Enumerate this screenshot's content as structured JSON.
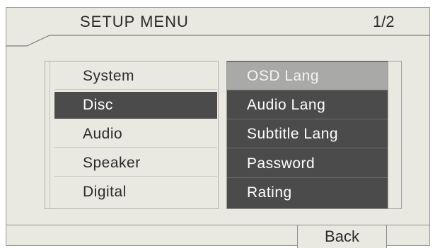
{
  "header": {
    "title": "SETUP MENU",
    "page_indicator": "1/2"
  },
  "left_menu": {
    "items": [
      {
        "label": "System",
        "selected": false
      },
      {
        "label": "Disc",
        "selected": true
      },
      {
        "label": "Audio",
        "selected": false
      },
      {
        "label": "Speaker",
        "selected": false
      },
      {
        "label": "Digital",
        "selected": false
      }
    ]
  },
  "right_menu": {
    "items": [
      {
        "label": "OSD Lang",
        "selected": true
      },
      {
        "label": "Audio Lang",
        "selected": false
      },
      {
        "label": "Subtitle Lang",
        "selected": false
      },
      {
        "label": "Password",
        "selected": false
      },
      {
        "label": "Rating",
        "selected": false
      }
    ]
  },
  "footer": {
    "back_label": "Back"
  },
  "colors": {
    "panel_bg": "#eae9e1",
    "selected_dark": "#4b4b4b",
    "selected_light": "#a9a9a7",
    "border": "#9b9b97"
  }
}
